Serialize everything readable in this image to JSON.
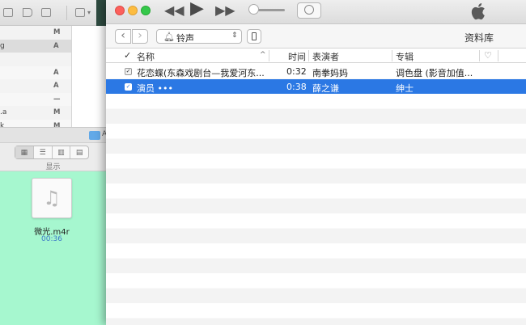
{
  "background_window": {
    "list_rows": [
      {
        "name": "",
        "status": "M"
      },
      {
        "name": "g",
        "status": "A"
      },
      {
        "name": "",
        "status": ""
      },
      {
        "name": "",
        "status": "A"
      },
      {
        "name": "",
        "status": "A"
      },
      {
        "name": "",
        "status": "—"
      },
      {
        "name": ".a",
        "status": "M"
      },
      {
        "name": "k",
        "status": "M"
      }
    ],
    "finder_path": "A",
    "view_label": "显示",
    "file": {
      "name": "微光.m4r",
      "duration": "00:36"
    }
  },
  "player": {
    "library_selector": "铃声",
    "library_label": "资料库"
  },
  "table": {
    "columns": {
      "check": "✓",
      "name": "名称",
      "time": "时间",
      "artist": "表演者",
      "album": "专辑",
      "love": "♡"
    },
    "rows": [
      {
        "checked": "✓",
        "name": "花恋蝶(东森戏剧台—我爱河东...",
        "time": "0:32",
        "artist": "南拳妈妈",
        "album": "调色盘 (影音加值...",
        "selected": false
      },
      {
        "checked": "✓",
        "name": "演员 •••",
        "time": "0:38",
        "artist": "薛之谦",
        "album": "绅士",
        "selected": true
      }
    ]
  }
}
